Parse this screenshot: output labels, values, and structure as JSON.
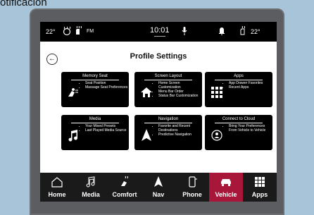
{
  "caption": "otificación",
  "status": {
    "temp_left": "22°",
    "band": "FM",
    "time": "10:01",
    "temp_right": "22°"
  },
  "page_title": "Profile Settings",
  "tiles": [
    {
      "title": "Memory Seat",
      "icon": "seat-icon",
      "items": [
        "Seat Position",
        "Massage Seat Preferences"
      ]
    },
    {
      "title": "Screen Layout",
      "icon": "home-icon",
      "items": [
        "Home Screen Customization",
        "Menu Bar Order",
        "Status Bar Customization"
      ]
    },
    {
      "title": "Apps",
      "icon": "apps-grid-icon",
      "items": [
        "App Drawer Favorites",
        "Recent Apps"
      ]
    },
    {
      "title": "Media",
      "icon": "music-note-icon",
      "items": [
        "Your Mixed Presets",
        "Last Played Media Source"
      ]
    },
    {
      "title": "Navigation",
      "icon": "navigation-arrow-icon",
      "items": [
        "Favorite and Recent Destinations",
        "Predictive Navigation"
      ]
    },
    {
      "title": "Connect to Cloud",
      "icon": "cloud-profile-icon",
      "items": [
        "Bring Your Preferences From Vehicle to Vehicle"
      ]
    }
  ],
  "nav": [
    {
      "label": "Home",
      "icon": "home-outline-icon"
    },
    {
      "label": "Media",
      "icon": "music-note-icon"
    },
    {
      "label": "Comfort",
      "icon": "seat-heat-icon"
    },
    {
      "label": "Nav",
      "icon": "navigation-arrow-icon"
    },
    {
      "label": "Phone",
      "icon": "phone-icon"
    },
    {
      "label": "Vehicle",
      "icon": "car-icon"
    },
    {
      "label": "Apps",
      "icon": "apps-grid-icon"
    }
  ],
  "colors": {
    "active_nav": "#a8163a",
    "tile_bg": "#000000",
    "bezel": "#5b5d61"
  }
}
